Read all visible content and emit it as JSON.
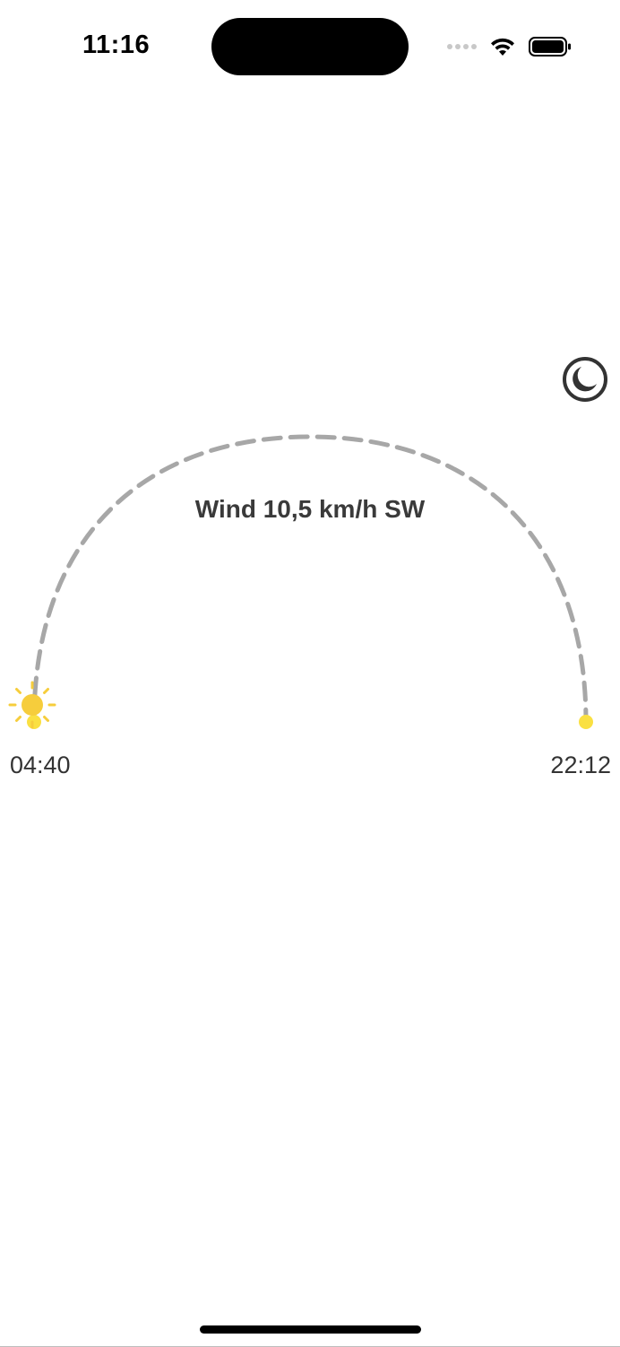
{
  "status_bar": {
    "time": "11:16"
  },
  "icons": {
    "moon": "moon-icon",
    "sun": "sun-icon"
  },
  "sun_arc": {
    "wind_text": "Wind 10,5 km/h SW",
    "sunrise": "04:40",
    "sunset": "22:12",
    "progress": 0.0
  },
  "colors": {
    "arc_dash": "#a7a7a7",
    "sun": "#f6cd3c",
    "endpoint": "#fae042",
    "text": "#333333"
  }
}
